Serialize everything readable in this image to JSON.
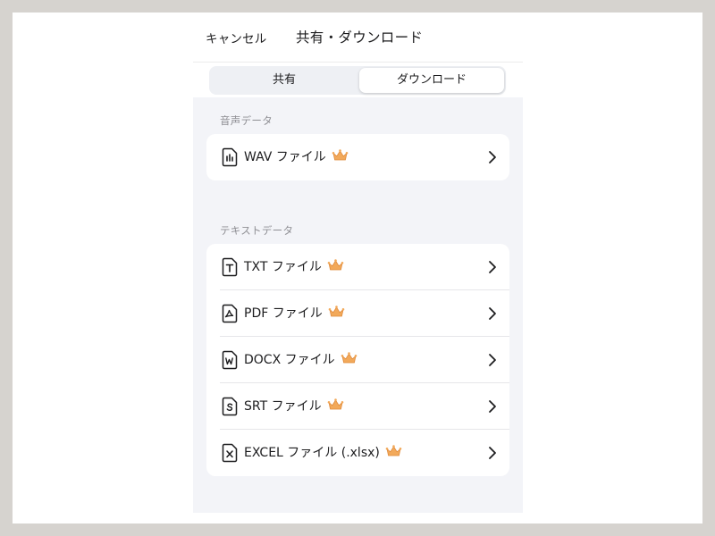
{
  "nav": {
    "cancel_label": "キャンセル",
    "title": "共有・ダウンロード"
  },
  "tabs": {
    "share_label": "共有",
    "download_label": "ダウンロード",
    "selected": "download"
  },
  "sections": {
    "audio": {
      "label": "音声データ",
      "items": [
        {
          "label": "WAV ファイル",
          "icon": "audio-file-icon",
          "premium": true
        }
      ]
    },
    "text": {
      "label": "テキストデータ",
      "items": [
        {
          "label": "TXT ファイル",
          "icon": "txt-file-icon",
          "premium": true
        },
        {
          "label": "PDF ファイル",
          "icon": "pdf-file-icon",
          "premium": true
        },
        {
          "label": "DOCX ファイル",
          "icon": "docx-file-icon",
          "premium": true
        },
        {
          "label": "SRT ファイル",
          "icon": "srt-file-icon",
          "premium": true
        },
        {
          "label": "EXCEL ファイル (.xlsx)",
          "icon": "excel-file-icon",
          "premium": true
        }
      ]
    }
  },
  "colors": {
    "background": "#f3f4f8",
    "card": "#ffffff",
    "crown": "#f2a95a",
    "secondary_text": "#8e8e93"
  }
}
